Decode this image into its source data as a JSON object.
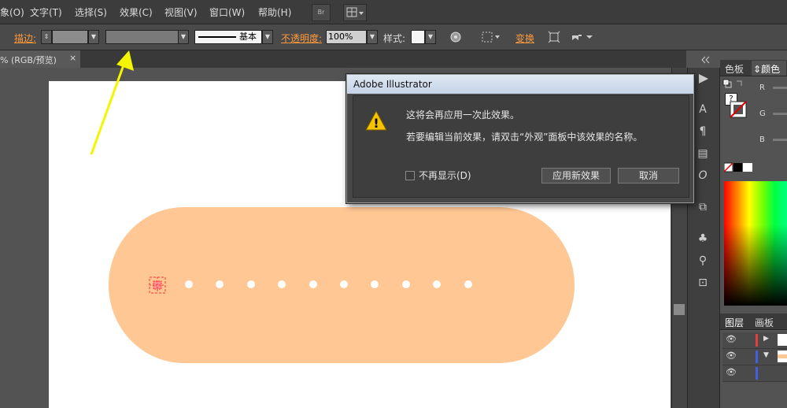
{
  "menu": {
    "items": [
      "象(O)",
      "文字(T)",
      "选择(S)",
      "效果(C)",
      "视图(V)",
      "窗口(W)",
      "帮助(H)"
    ],
    "br_label": "Br"
  },
  "control_bar": {
    "stroke_label": "描边:",
    "line_preset": "基本",
    "opacity_label": "不透明度:",
    "opacity_value": "100%",
    "style_label": "样式:",
    "transform_label": "变换"
  },
  "doc_tab": {
    "title": "% (RGB/预览)",
    "close": "×"
  },
  "dialog": {
    "title": "Adobe Illustrator",
    "message_1": "这将会再应用一次此效果。",
    "message_2": "若要编辑当前效果，请双击“外观”面板中该效果的名称。",
    "checkbox_label": "不再显示(D)",
    "apply_button": "应用新效果",
    "cancel_button": "取消",
    "warning_glyph": "!"
  },
  "color_panel": {
    "tab_swatches": "色板",
    "tab_color": "颜色",
    "channels": [
      "R",
      "G",
      "B"
    ],
    "help_glyph": "?"
  },
  "layers_panel": {
    "tab_layers": "图层",
    "tab_artboards": "画板"
  },
  "artwork": {
    "band_color": "#ffc794",
    "dot_count": 11
  },
  "colors": {
    "accent_orange": "#ff9a3c",
    "arrow_yellow": "#f5f500",
    "warning_yellow": "#f5c400"
  }
}
